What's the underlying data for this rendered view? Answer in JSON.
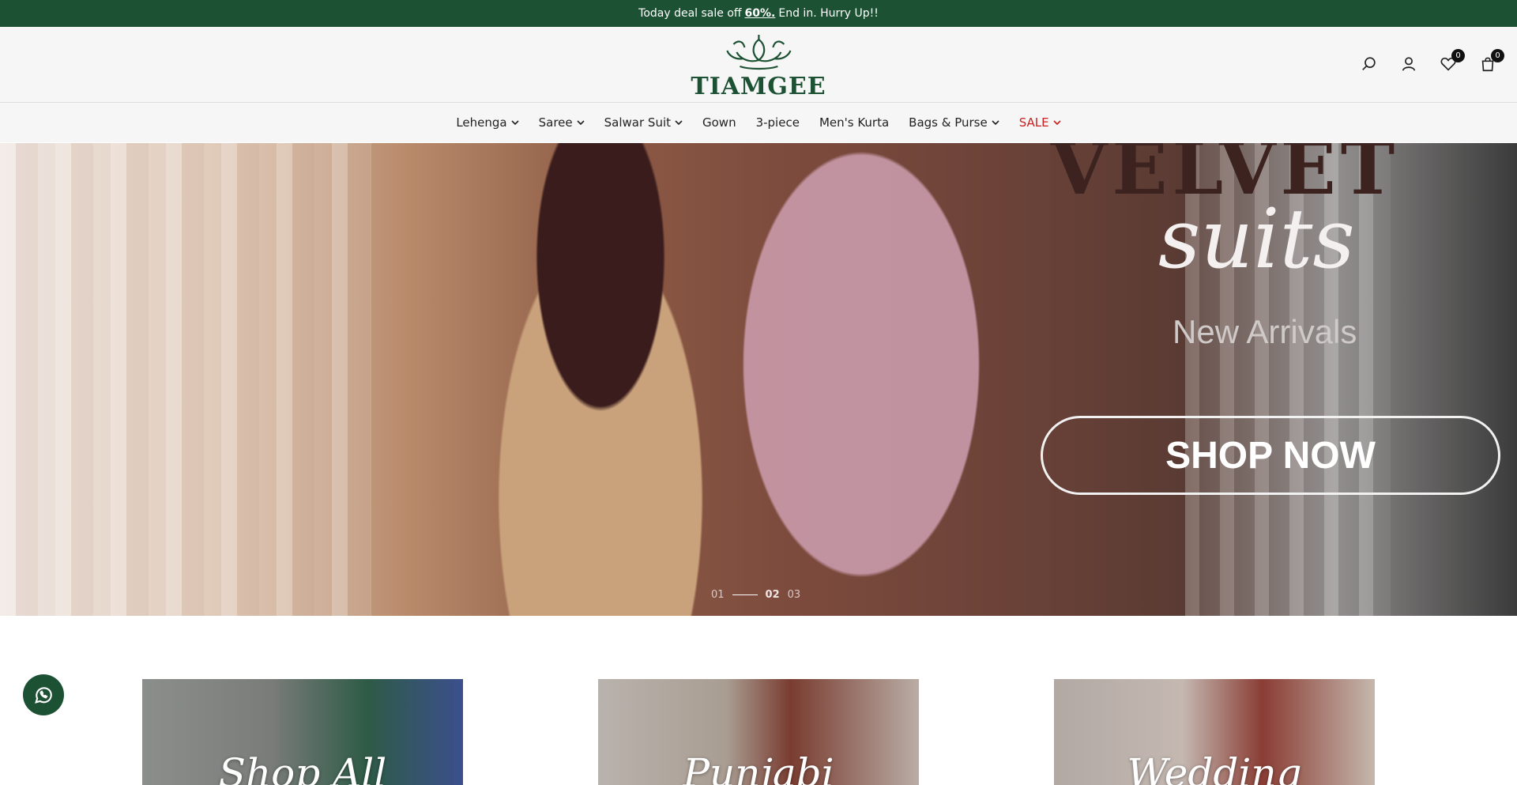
{
  "announcement": {
    "prefix": "Today deal sale off",
    "highlight": "60%.",
    "suffix": "End in. Hurry Up!!"
  },
  "header": {
    "logo_text": "TIAMGEE",
    "wishlist_count": "0",
    "cart_count": "0",
    "icons": [
      "search-icon",
      "user-icon",
      "heart-icon",
      "bag-icon"
    ]
  },
  "nav": {
    "items": [
      {
        "label": "Lehenga",
        "dropdown": true
      },
      {
        "label": "Saree",
        "dropdown": true
      },
      {
        "label": "Salwar Suit",
        "dropdown": true
      },
      {
        "label": "Gown",
        "dropdown": false
      },
      {
        "label": "3-piece",
        "dropdown": false
      },
      {
        "label": "Men's Kurta",
        "dropdown": false
      },
      {
        "label": "Bags & Purse",
        "dropdown": true
      },
      {
        "label": "SALE",
        "dropdown": true
      }
    ]
  },
  "hero": {
    "title": "VELVET",
    "subtitle": "suits",
    "tagline": "New Arrivals",
    "cta": "SHOP NOW",
    "slides": [
      "01",
      "02",
      "03"
    ],
    "active_slide": "02"
  },
  "categories": [
    {
      "label": "Shop All"
    },
    {
      "label": "Punjabi"
    },
    {
      "label": "Wedding"
    }
  ],
  "colors": {
    "brand_green": "#1d5133",
    "sale_red": "#cc1f1f"
  }
}
